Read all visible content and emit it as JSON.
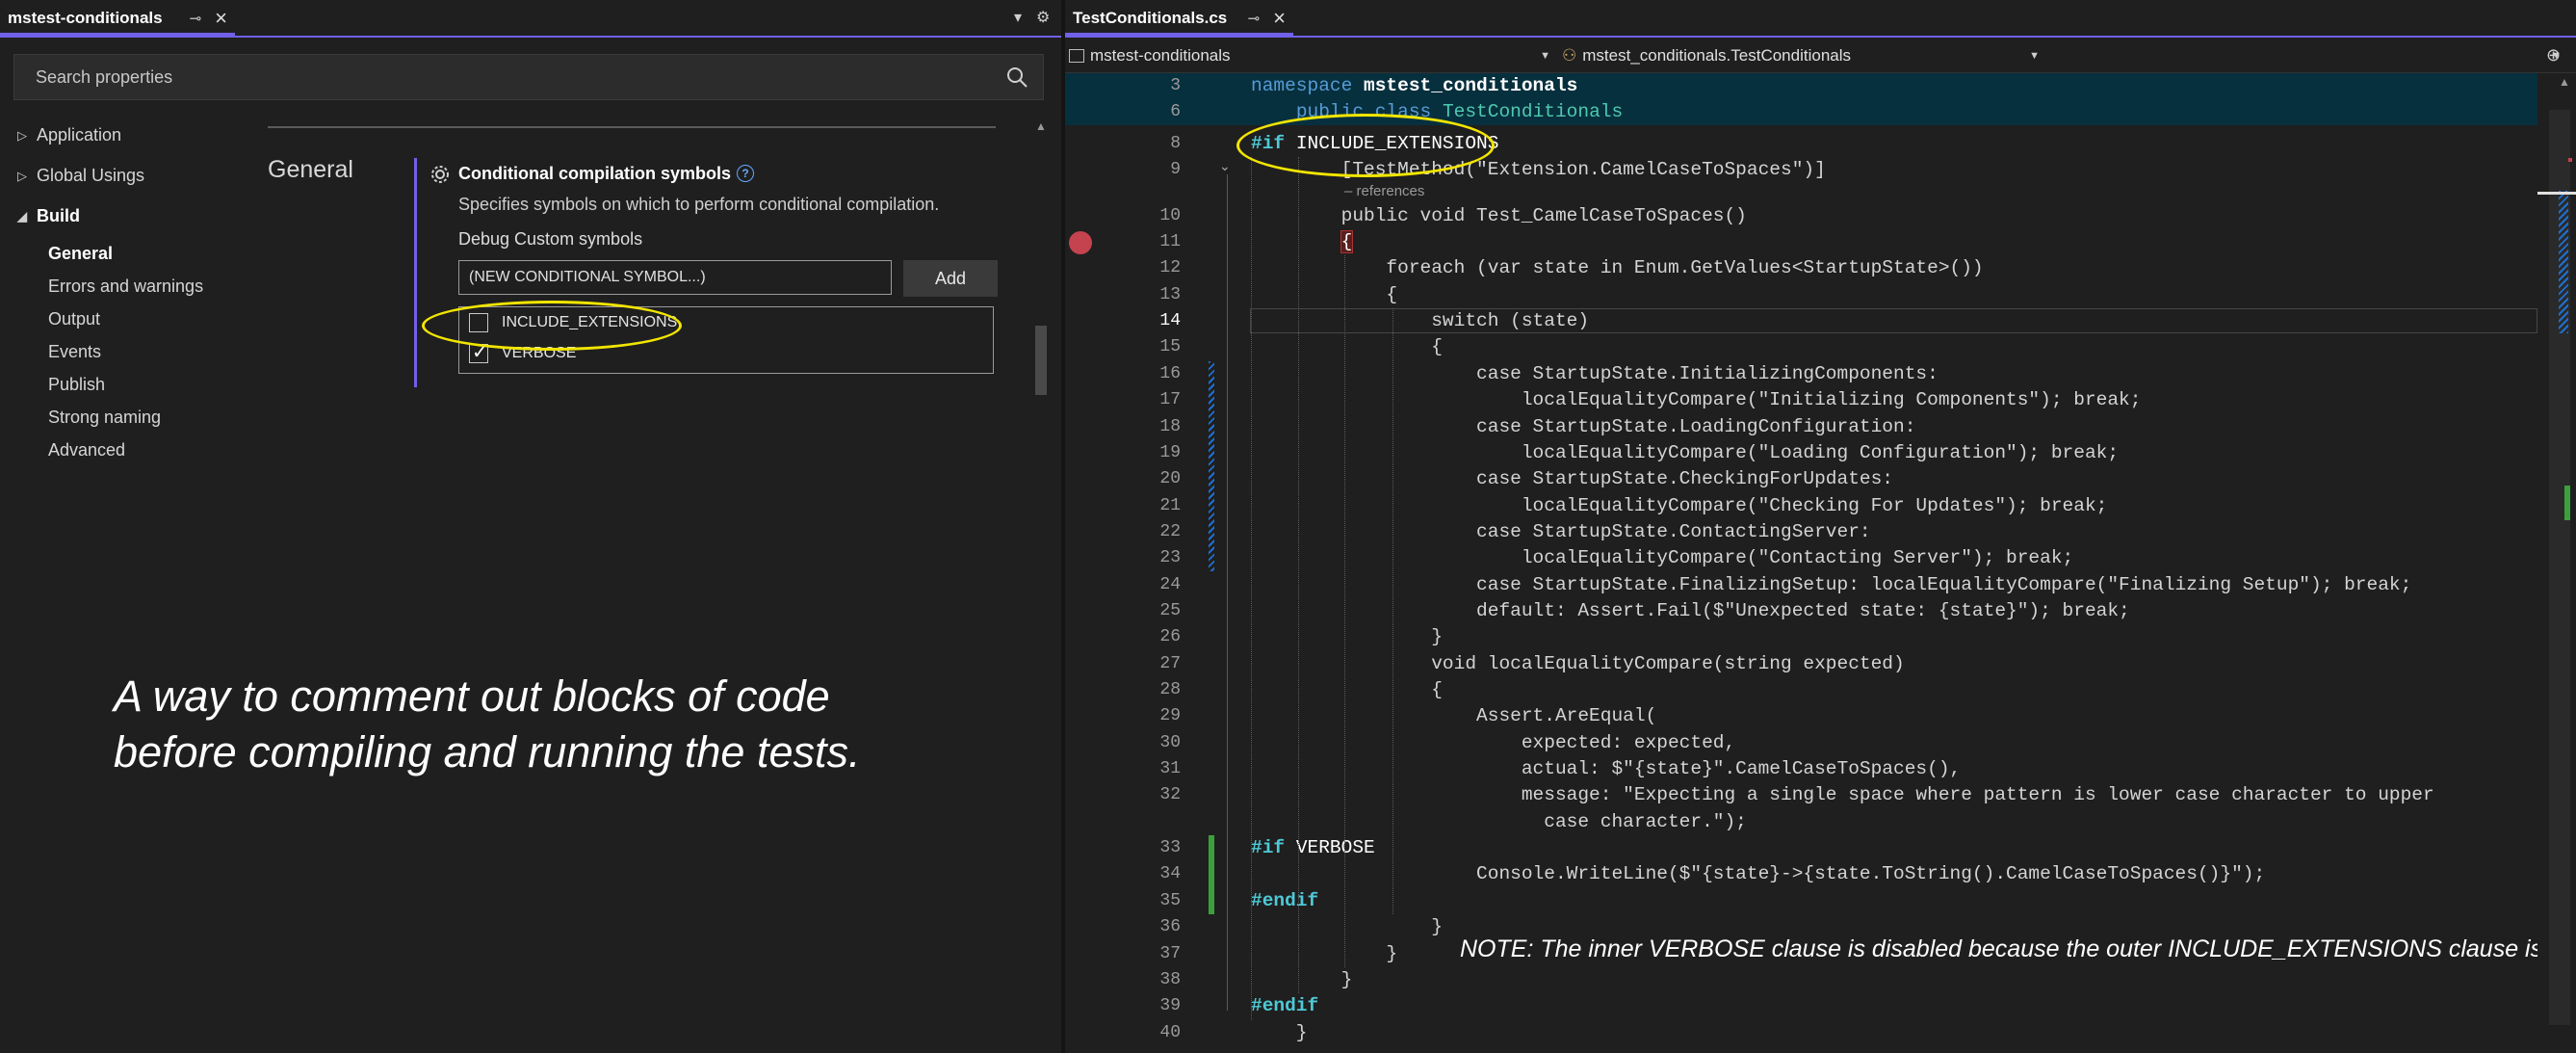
{
  "left_panel": {
    "tab_title": "mstest-conditionals",
    "search_placeholder": "Search properties",
    "nav": {
      "application": "Application",
      "global_usings": "Global Usings",
      "build": "Build",
      "general": "General",
      "errors_warnings": "Errors and warnings",
      "output": "Output",
      "events": "Events",
      "publish": "Publish",
      "strong_naming": "Strong naming",
      "advanced": "Advanced"
    },
    "section_title": "General",
    "property": {
      "title": "Conditional compilation symbols",
      "description": "Specifies symbols on which to perform conditional compilation.",
      "subheading": "Debug Custom symbols",
      "input_value": "(NEW CONDITIONAL SYMBOL...)",
      "add_label": "Add",
      "symbols": [
        {
          "name": "INCLUDE_EXTENSIONS",
          "checked": false
        },
        {
          "name": "VERBOSE",
          "checked": true
        }
      ]
    },
    "caption_line1": "A way to comment out blocks of code",
    "caption_line2": "before compiling and running the tests.",
    "highlight_color": "#f2e500"
  },
  "editor": {
    "tab_title": "TestConditionals.cs",
    "project_dropdown": "mstest-conditionals",
    "class_dropdown": "mstest_conditionals.TestConditionals",
    "references_label": "– references",
    "note": "NOTE: The inner VERBOSE clause is disabled because the outer INCLUDE_EXTENSIONS clause is.",
    "current_line": 14,
    "lines": [
      {
        "n": "3",
        "code": "namespace mstest_conditionals"
      },
      {
        "n": "6",
        "code": "    public class TestConditionals"
      },
      {
        "n": "8",
        "code": "#if INCLUDE_EXTENSIONS"
      },
      {
        "n": "9",
        "code": "        [TestMethod(\"Extension.CamelCaseToSpaces\")]"
      },
      {
        "n": "10",
        "code": "        public void Test_CamelCaseToSpaces()"
      },
      {
        "n": "11",
        "code": "        {"
      },
      {
        "n": "12",
        "code": "            foreach (var state in Enum.GetValues<StartupState>())"
      },
      {
        "n": "13",
        "code": "            {"
      },
      {
        "n": "14",
        "code": "                switch (state)"
      },
      {
        "n": "15",
        "code": "                {"
      },
      {
        "n": "16",
        "code": "                    case StartupState.InitializingComponents:"
      },
      {
        "n": "17",
        "code": "                        localEqualityCompare(\"Initializing Components\"); break;"
      },
      {
        "n": "18",
        "code": "                    case StartupState.LoadingConfiguration:"
      },
      {
        "n": "19",
        "code": "                        localEqualityCompare(\"Loading Configuration\"); break;"
      },
      {
        "n": "20",
        "code": "                    case StartupState.CheckingForUpdates:"
      },
      {
        "n": "21",
        "code": "                        localEqualityCompare(\"Checking For Updates\"); break;"
      },
      {
        "n": "22",
        "code": "                    case StartupState.ContactingServer:"
      },
      {
        "n": "23",
        "code": "                        localEqualityCompare(\"Contacting Server\"); break;"
      },
      {
        "n": "24",
        "code": "                    case StartupState.FinalizingSetup: localEqualityCompare(\"Finalizing Setup\"); break;"
      },
      {
        "n": "25",
        "code": "                    default: Assert.Fail($\"Unexpected state: {state}\"); break;"
      },
      {
        "n": "26",
        "code": "                }"
      },
      {
        "n": "27",
        "code": "                void localEqualityCompare(string expected)"
      },
      {
        "n": "28",
        "code": "                {"
      },
      {
        "n": "29",
        "code": "                    Assert.AreEqual("
      },
      {
        "n": "30",
        "code": "                        expected: expected,"
      },
      {
        "n": "31",
        "code": "                        actual: $\"{state}\".CamelCaseToSpaces(),"
      },
      {
        "n": "32",
        "code": "                        message: \"Expecting a single space where pattern is lower case character to upper"
      },
      {
        "n": "",
        "code": "                          case character.\");"
      },
      {
        "n": "33",
        "code": "#if VERBOSE"
      },
      {
        "n": "34",
        "code": "                    Console.WriteLine($\"{state}->{state.ToString().CamelCaseToSpaces()}\");"
      },
      {
        "n": "35",
        "code": "#endif"
      },
      {
        "n": "36",
        "code": "                }"
      },
      {
        "n": "37",
        "code": "            }"
      },
      {
        "n": "38",
        "code": "        }"
      },
      {
        "n": "39",
        "code": "#endif"
      },
      {
        "n": "40",
        "code": "    }"
      }
    ],
    "colors": {
      "keyword": "#569cd6",
      "type": "#4ec9b0",
      "directive": "#4ec9d6",
      "breakpoint": "#c5424f",
      "sticky_bg": "#07303e",
      "accent": "#7160e8"
    }
  }
}
